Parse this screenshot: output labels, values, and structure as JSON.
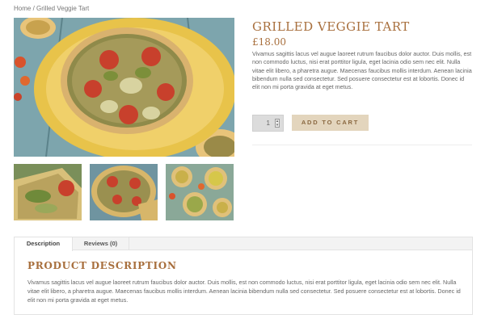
{
  "breadcrumb": {
    "home": "Home",
    "separator": " / ",
    "current": "Grilled Veggie Tart"
  },
  "product": {
    "title": "GRILLED VEGGIE TART",
    "price": "£18.00",
    "short_description": "Vivamus sagittis lacus vel augue laoreet rutrum faucibus dolor auctor. Duis mollis, est non commodo luctus, nisi erat porttitor ligula, eget lacinia odio sem nec elit. Nulla vitae elit libero, a pharetra augue. Maecenas faucibus mollis interdum. Aenean lacinia bibendum nulla sed consectetur. Sed posuere consectetur est at lobortis. Donec id elit non mi porta gravida at eget metus.",
    "quantity": "1",
    "add_to_cart_label": "ADD TO CART"
  },
  "gallery": {
    "main_image": "grilled-veggie-tart-photo",
    "thumbnails": [
      "tart-slice-photo",
      "sliced-tart-photo",
      "mini-tarts-photo"
    ]
  },
  "tabs": [
    {
      "label": "Description",
      "active": true
    },
    {
      "label": "Reviews (0)",
      "active": false
    }
  ],
  "description_panel": {
    "heading": "PRODUCT DESCRIPTION",
    "body": "Vivamus sagittis lacus vel augue laoreet rutrum faucibus dolor auctor. Duis mollis, est non commodo luctus, nisi erat porttitor ligula, eget lacinia odio sem nec elit. Nulla vitae elit libero, a pharetra augue. Maecenas faucibus mollis interdum. Aenean lacinia bibendum nulla sed consectetur. Sed posuere consectetur est at lobortis. Donec id elit non mi porta gravida at eget metus."
  },
  "colors": {
    "accent": "#a86f3d",
    "button_bg": "#e3d5bd",
    "button_text": "#8a6840"
  }
}
